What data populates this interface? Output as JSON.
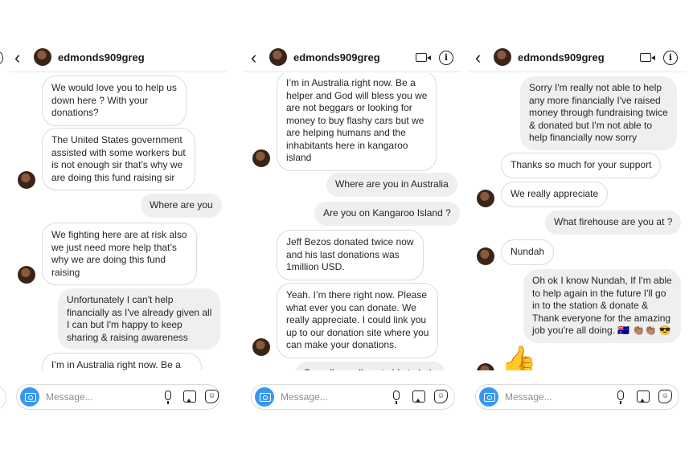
{
  "header": {
    "username": "edmonds909greg"
  },
  "composer": {
    "placeholder": "Message..."
  },
  "panels": [
    {
      "messages": [
        "We would love you to help us\ndown here ? With your\ndonations?",
        "The United States government\nassisted with some workers but\nis not enough sir that’s why we\nare doing this fund raising sir",
        "Where are you",
        "We fighting here are at risk also\nwe just need more help that’s\nwhy we are doing this fund\nraising",
        "Unfortunately I can't help\nfinancially as I've already given all\nI can but I'm happy to keep\nsharing & raising awareness",
        "I’m in Australia right now. Be a\nhelper and God will bless you we"
      ]
    },
    {
      "messages": [
        "I’m in Australia right now. Be a\nhelper and God will bless you we\nare not beggars or looking for\nmoney to buy flashy cars but we\nare helping humans and the\ninhabitants here in kangaroo\nisland",
        "Where are you in Australia",
        "Are you on Kangaroo Island ?",
        "Jeff Bezos donated twice now\nand his last donations was\n1million USD.",
        "Yeah. I’m there right now. Please\nwhat ever you can donate. We\nreally appreciate. I could link you\nup to our donation site where you\ncan make your donations.",
        "Sorry I'm really not able to help"
      ]
    },
    {
      "messages": [
        "Sorry I'm really not able to help\nany more financially I've raised\nmoney through fundraising twice\n& donated but I'm not able to\nhelp financially now sorry",
        "Thanks so much for your support",
        "We really appreciate",
        "What firehouse are you at ?",
        "Nundah",
        "Oh ok I know Nundah, If I'm able\nto help again in the future I'll go\nin to the station & donate &\nThank everyone for the amazing\njob you're all doing. 🇦🇺 👏🏽👏🏽 😎",
        "👍"
      ]
    }
  ]
}
